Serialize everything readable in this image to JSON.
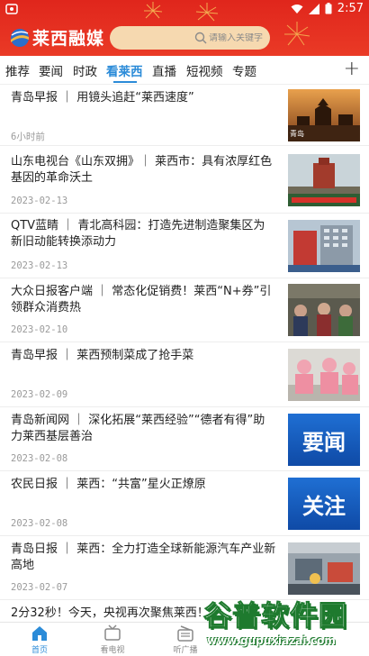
{
  "status_bar": {
    "time": "2:57"
  },
  "header": {
    "app_title": "莱西融媒",
    "search_placeholder": "请输入关键字"
  },
  "tabs": [
    {
      "label": "推荐"
    },
    {
      "label": "要闻"
    },
    {
      "label": "时政"
    },
    {
      "label": "看莱西",
      "active": true
    },
    {
      "label": "直播"
    },
    {
      "label": "短视频"
    },
    {
      "label": "专题"
    }
  ],
  "add_tab_label": "+",
  "articles": [
    {
      "title": "青岛早报 ｜ 用镜头追赶“莱西速度”",
      "date": "6小时前",
      "thumb": "sunset-tower",
      "thumb_caption": "青岛"
    },
    {
      "title": "山东电视台《山东双拥》｜ 莱西市：具有浓厚红色基因的革命沃土",
      "date": "2023-02-13",
      "thumb": "memorial"
    },
    {
      "title": "QTV蓝睛 ｜ 青北高科园：打造先进制造聚集区为新旧动能转换添动力",
      "date": "2023-02-13",
      "thumb": "building"
    },
    {
      "title": "大众日报客户端 ｜ 常态化促销费！莱西“N+券”引领群众消费热",
      "date": "2023-02-10",
      "thumb": "market"
    },
    {
      "title": "青岛早报 ｜ 莱西预制菜成了抢手菜",
      "date": "2023-02-09",
      "thumb": "kitchen"
    },
    {
      "title": "青岛新闻网 ｜ 深化拓展“莱西经验”“德者有得”助力莱西基层善治",
      "date": "2023-02-08",
      "thumb": "blue-card",
      "thumb_caption": "要闻"
    },
    {
      "title": "农民日报 ｜ 莱西：“共富”星火正燎原",
      "date": "2023-02-08",
      "thumb": "blue-card",
      "thumb_caption": "关注"
    },
    {
      "title": "青岛日报 ｜ 莱西：全力打造全球新能源汽车产业新高地",
      "date": "2023-02-07",
      "thumb": "factory"
    },
    {
      "title": "2分32秒！今天，央视再次聚焦莱西！",
      "date": "",
      "thumb": "none"
    }
  ],
  "bottom_nav": [
    {
      "label": "首页",
      "icon": "home-icon",
      "active": true
    },
    {
      "label": "看电视",
      "icon": "tv-icon"
    },
    {
      "label": "听广播",
      "icon": "radio-icon"
    }
  ],
  "watermark": {
    "big": "谷普软件园",
    "small": "www.gupuxiazai.com"
  },
  "colors": {
    "header_red": "#e0261c",
    "accent_blue": "#2b8bd8"
  }
}
